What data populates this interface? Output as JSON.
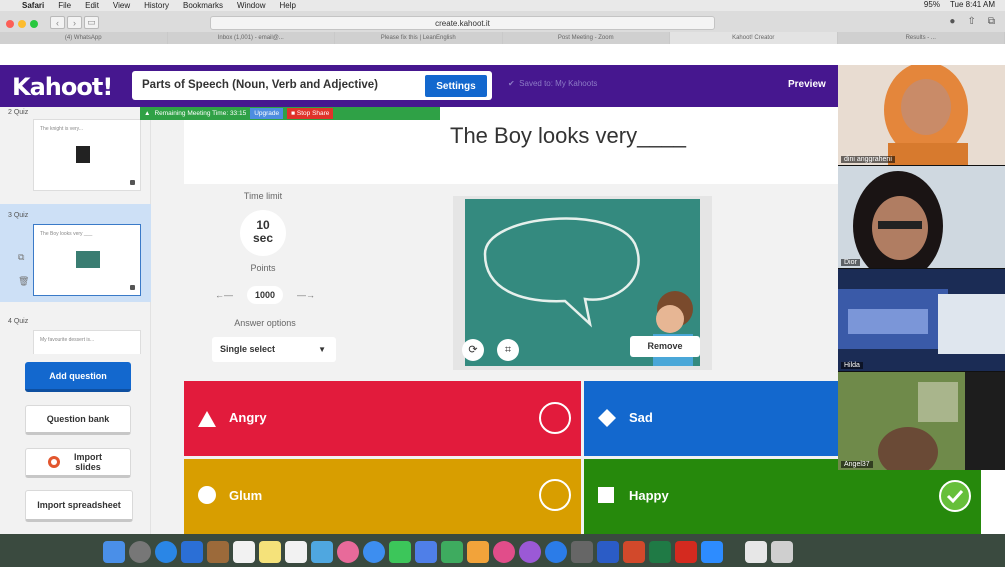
{
  "menubar": {
    "items": [
      "Safari",
      "File",
      "Edit",
      "View",
      "History",
      "Bookmarks",
      "Window",
      "Help"
    ],
    "status": [
      "95%",
      "Tue 8:41 AM"
    ]
  },
  "browser": {
    "url": "create.kahoot.it",
    "tabs": [
      "(4) WhatsApp",
      "Inbox (1,001) - email@...",
      "Please fix this | LeanEnglish",
      "Post Meeting - Zoom",
      "Kahoot! Creator",
      "Results - ..."
    ]
  },
  "kahoot": {
    "logo": "Kahoot!",
    "title": "Parts of Speech (Noun, Verb and Adjective)",
    "settings_label": "Settings",
    "saved_label": "Saved to: My Kahoots",
    "preview_label": "Preview"
  },
  "zoom_bar": {
    "remaining": "Remaining Meeting Time: 33:15",
    "upgrade": "Upgrade",
    "stop": "Stop Share"
  },
  "sidebar": {
    "slides": [
      {
        "num": "2 Quiz",
        "text": "The knight is very..."
      },
      {
        "num": "3 Quiz",
        "text": "The Boy looks very ___"
      },
      {
        "num": "4 Quiz",
        "text": "My favourite dessert is..."
      }
    ],
    "add_question": "Add question",
    "question_bank": "Question bank",
    "import_slides": "Import slides",
    "import_spreadsheet": "Import spreadsheet"
  },
  "question": {
    "text": "The Boy looks very____",
    "time_limit_label": "Time limit",
    "time_value": "10",
    "time_unit": "sec",
    "points_label": "Points",
    "points_value": "1000",
    "answer_options_label": "Answer options",
    "answer_type": "Single select",
    "remove_label": "Remove"
  },
  "answers": [
    {
      "label": "Angry",
      "color": "#e21b3c",
      "shape": "triangle",
      "correct": false
    },
    {
      "label": "Sad",
      "color": "#1368ce",
      "shape": "diamond",
      "correct": false
    },
    {
      "label": "Glum",
      "color": "#d89e00",
      "shape": "circle",
      "correct": false
    },
    {
      "label": "Happy",
      "color": "#26890c",
      "shape": "square",
      "correct": true
    }
  ],
  "participants": [
    {
      "name": "dini anggraheni"
    },
    {
      "name": "Dior"
    },
    {
      "name": "Hilda"
    },
    {
      "name": "Angel37"
    }
  ]
}
